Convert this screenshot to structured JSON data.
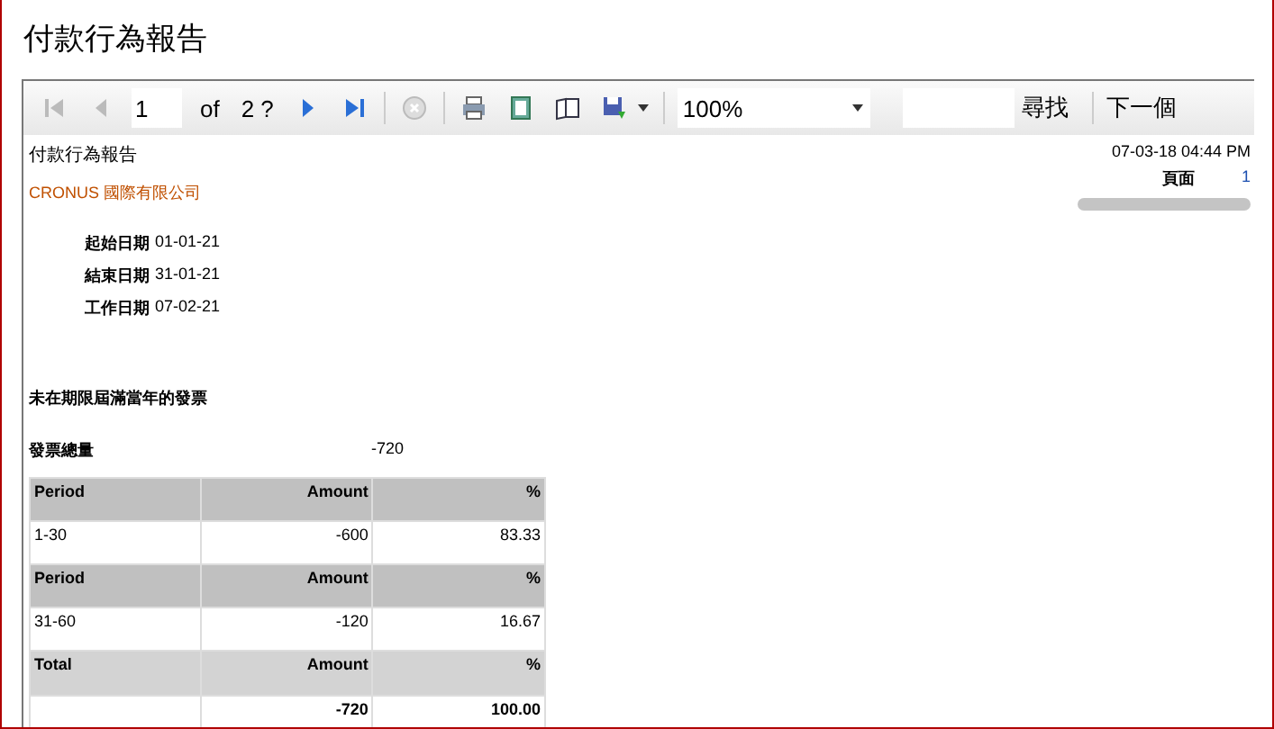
{
  "window": {
    "title": "付款行為報告"
  },
  "toolbar": {
    "page": "1",
    "of_label": "of",
    "page_count": "2 ?",
    "zoom": "100%",
    "find_label": "尋找",
    "next_label": "下一個"
  },
  "report": {
    "title": "付款行為報告",
    "company": "CRONUS 國際有限公司",
    "printed": "07-03-18 04:44 PM",
    "page_label": "頁面",
    "page_number": "1",
    "dates": [
      {
        "label": "起始日期",
        "value": "01-01-21"
      },
      {
        "label": "結束日期",
        "value": "31-01-21"
      },
      {
        "label": "工作日期",
        "value": "07-02-21"
      }
    ],
    "section_title": "未在期限屆滿當年的發票",
    "total_label": "發票總量",
    "total_value": "-720",
    "table": {
      "rows": [
        {
          "kind": "header",
          "cells": [
            "Period",
            "Amount",
            "%"
          ]
        },
        {
          "kind": "data",
          "cells": [
            "1-30",
            "-600",
            "83.33"
          ]
        },
        {
          "kind": "header",
          "cells": [
            "Period",
            "Amount",
            "%"
          ]
        },
        {
          "kind": "data",
          "cells": [
            "31-60",
            "-120",
            "16.67"
          ]
        },
        {
          "kind": "total_header",
          "cells": [
            "Total",
            "Amount",
            "%"
          ]
        },
        {
          "kind": "total",
          "cells": [
            "",
            "-720",
            "100.00"
          ]
        }
      ]
    }
  }
}
